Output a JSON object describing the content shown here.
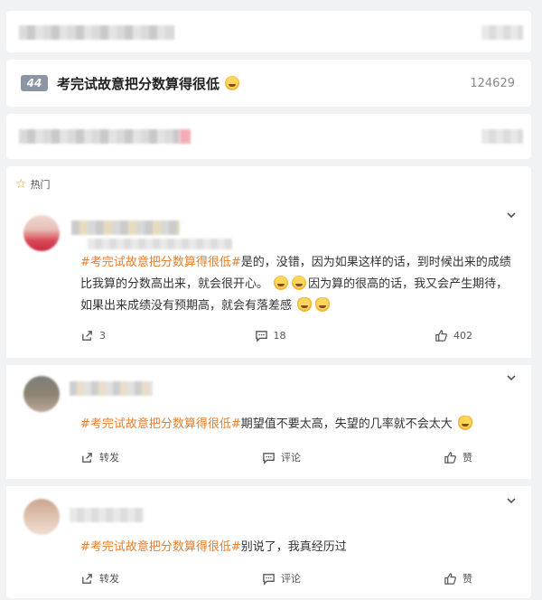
{
  "trend": {
    "rank": "44",
    "title": "考完试故意把分数算得很低",
    "count": "124629"
  },
  "hot_section": {
    "label": "热门"
  },
  "comments": [
    {
      "topic": "#考完试故意把分数算得很低#",
      "body": "是的，没错，因为如果这样的话，到时候出来的成绩比我算的分数高出来，就会很开心。",
      "body2": "因为算的很高的话，我又会产生期待，如果出来成绩没有预期高，就会有落差感",
      "reposts": "3",
      "comments": "18",
      "likes": "402"
    },
    {
      "topic": "#考完试故意把分数算得很低#",
      "body": "期望值不要太高，失望的几率就不会太大",
      "reposts": "转发",
      "comments": "评论",
      "likes": "赞"
    },
    {
      "topic": "#考完试故意把分数算得很低#",
      "body": "别说了，我真经历过",
      "reposts": "转发",
      "comments": "评论",
      "likes": "赞"
    }
  ]
}
